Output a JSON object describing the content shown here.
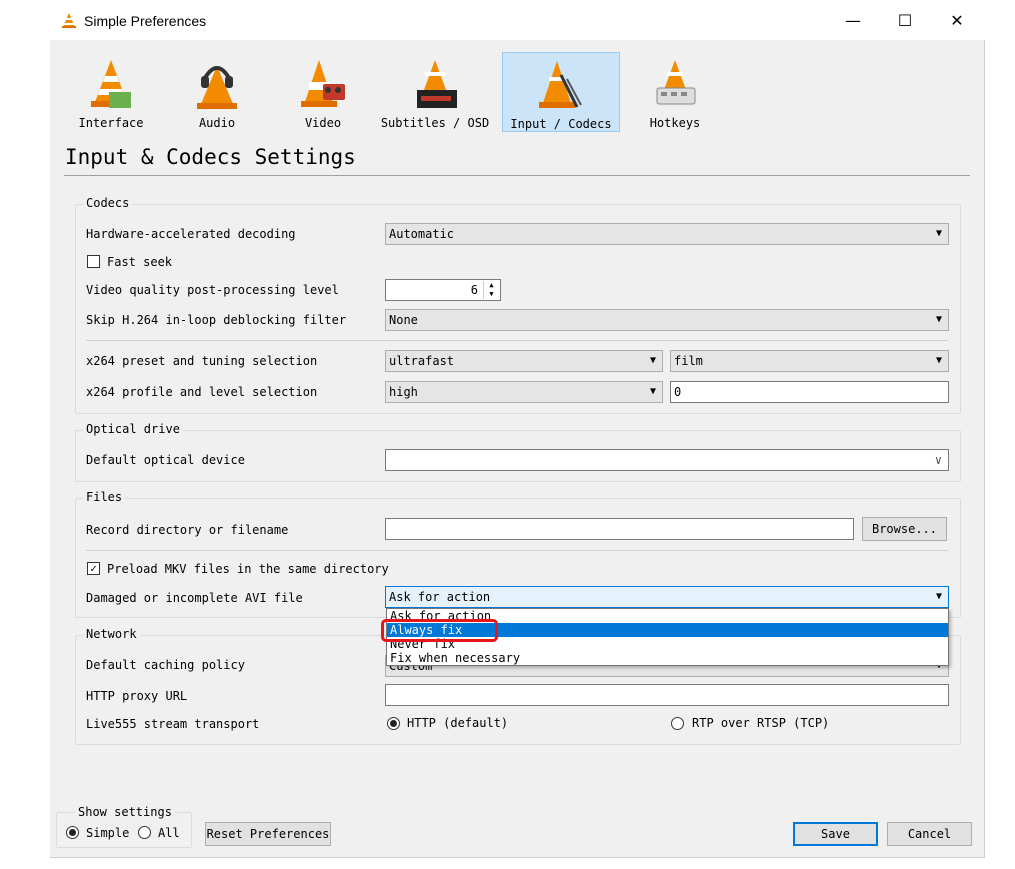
{
  "window": {
    "title": "Simple Preferences",
    "min": "—",
    "max": "☐",
    "close": "✕"
  },
  "tabs": [
    {
      "label": "Interface"
    },
    {
      "label": "Audio"
    },
    {
      "label": "Video"
    },
    {
      "label": "Subtitles / OSD"
    },
    {
      "label": "Input / Codecs"
    },
    {
      "label": "Hotkeys"
    }
  ],
  "active_tab": "Input / Codecs",
  "section_title": "Input & Codecs Settings",
  "codecs": {
    "group_label": "Codecs",
    "hw_decoding": {
      "label": "Hardware-accelerated decoding",
      "value": "Automatic"
    },
    "fast_seek": {
      "label": "Fast seek",
      "checked": false
    },
    "vq_level": {
      "label": "Video quality post-processing level",
      "value": "6"
    },
    "skip_h264": {
      "label": "Skip H.264 in-loop deblocking filter",
      "value": "None"
    },
    "x264_preset": {
      "label": "x264 preset and tuning selection",
      "preset": "ultrafast",
      "tuning": "film"
    },
    "x264_profile": {
      "label": "x264 profile and level selection",
      "profile": "high",
      "level": "0"
    }
  },
  "optical": {
    "group_label": "Optical drive",
    "device": {
      "label": "Default optical device",
      "value": ""
    }
  },
  "files": {
    "group_label": "Files",
    "record": {
      "label": "Record directory or filename",
      "value": "",
      "browse": "Browse..."
    },
    "preload_mkv": {
      "label": "Preload MKV files in the same directory",
      "checked": true
    },
    "damaged_avi": {
      "label": "Damaged or incomplete AVI file",
      "value": "Ask for action",
      "options": [
        "Ask for action",
        "Always fix",
        "Never fix",
        "Fix when necessary"
      ],
      "highlighted": "Always fix"
    }
  },
  "network": {
    "group_label": "Network",
    "caching": {
      "label": "Default caching policy",
      "value": "Custom"
    },
    "proxy": {
      "label": "HTTP proxy URL",
      "value": ""
    },
    "live555": {
      "label": "Live555 stream transport",
      "http": "HTTP (default)",
      "rtp": "RTP over RTSP (TCP)",
      "selected": "http"
    }
  },
  "bottom": {
    "show_settings": "Show settings",
    "simple": "Simple",
    "all": "All",
    "reset": "Reset Preferences",
    "save": "Save",
    "cancel": "Cancel"
  },
  "colors": {
    "selection": "#0078d7",
    "highlight_ring": "#e8161b",
    "active_tab_bg": "#cce4f7"
  }
}
